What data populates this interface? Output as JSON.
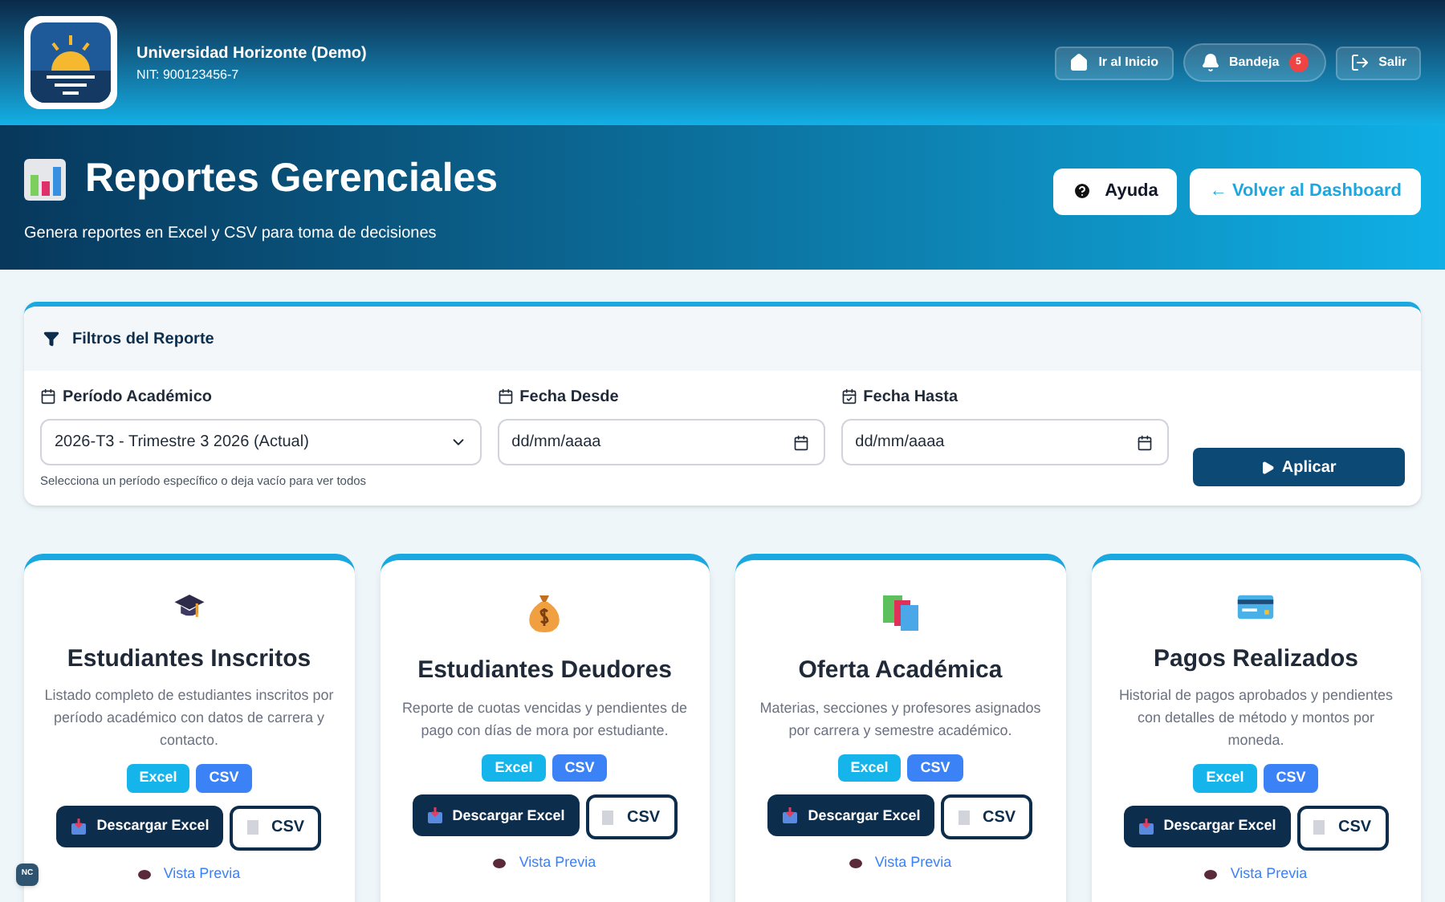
{
  "header": {
    "org_name": "Universidad Horizonte (Demo)",
    "org_id": "NIT: 900123456-7",
    "nav": [
      {
        "kind": "home",
        "label": "Ir al Inicio"
      },
      {
        "kind": "inbox",
        "label": "Bandeja",
        "badge": "5"
      },
      {
        "kind": "logout",
        "label": "Salir"
      }
    ]
  },
  "hero": {
    "title": "Reportes Gerenciales",
    "subtitle": "Genera reportes en Excel y CSV para toma de decisiones",
    "help_button": "Ayuda",
    "back_button": "← Volver al Dashboard"
  },
  "filters": {
    "title": "Filtros del Reporte",
    "period": {
      "label": "Período Académico",
      "value": "2026-T3 - Trimestre 3 2026 (Actual)",
      "hint": "Selecciona un período específico o deja vacío para ver todos"
    },
    "date_from": {
      "label": "Fecha Desde",
      "placeholder": "dd/mm/aaaa"
    },
    "date_to": {
      "label": "Fecha Hasta",
      "placeholder": "dd/mm/aaaa"
    },
    "apply_button": "Aplicar"
  },
  "reports": [
    {
      "kind": "graduation",
      "title": "Estudiantes Inscritos",
      "description": "Listado completo de estudiantes inscritos por período académico con datos de carrera y contacto.",
      "tags": [
        "Excel",
        "CSV"
      ],
      "excel_button": "Descargar Excel",
      "csv_button": "CSV",
      "preview_link": "Vista Previa"
    },
    {
      "kind": "money",
      "title": "Estudiantes Deudores",
      "description": "Reporte de cuotas vencidas y pendientes de pago con días de mora por estudiante.",
      "tags": [
        "Excel",
        "CSV"
      ],
      "excel_button": "Descargar Excel",
      "csv_button": "CSV",
      "preview_link": "Vista Previa"
    },
    {
      "kind": "books",
      "title": "Oferta Académica",
      "description": "Materias, secciones y profesores asignados por carrera y semestre académico.",
      "tags": [
        "Excel",
        "CSV"
      ],
      "excel_button": "Descargar Excel",
      "csv_button": "CSV",
      "preview_link": "Vista Previa"
    },
    {
      "kind": "card",
      "title": "Pagos Realizados",
      "description": "Historial de pagos aprobados y pendientes con detalles de método y montos por moneda.",
      "tags": [
        "Excel",
        "CSV"
      ],
      "excel_button": "Descargar Excel",
      "csv_button": "CSV",
      "preview_link": "Vista Previa"
    }
  ],
  "corner_badge": "NC"
}
